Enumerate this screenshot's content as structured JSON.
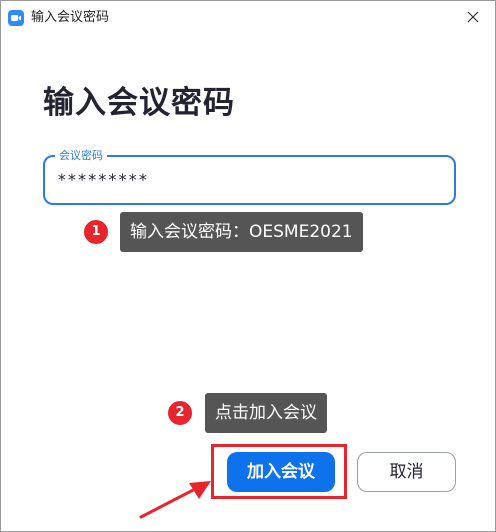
{
  "window": {
    "title": "输入会议密码",
    "app_icon": "zoom-camera-icon",
    "close_icon": "close-icon"
  },
  "main": {
    "heading": "输入会议密码",
    "password_field": {
      "label": "会议密码",
      "value": "*********"
    },
    "annotations": [
      {
        "number": "1",
        "text": "输入会议密码：OESME2021"
      },
      {
        "number": "2",
        "text": "点击加入会议"
      }
    ]
  },
  "buttons": {
    "join_label": "加入会议",
    "cancel_label": "取消"
  },
  "colors": {
    "accent": "#0e72ed",
    "focus_border": "#2d7be5",
    "annotation_red": "#e8242c",
    "tooltip_bg": "#555555"
  }
}
